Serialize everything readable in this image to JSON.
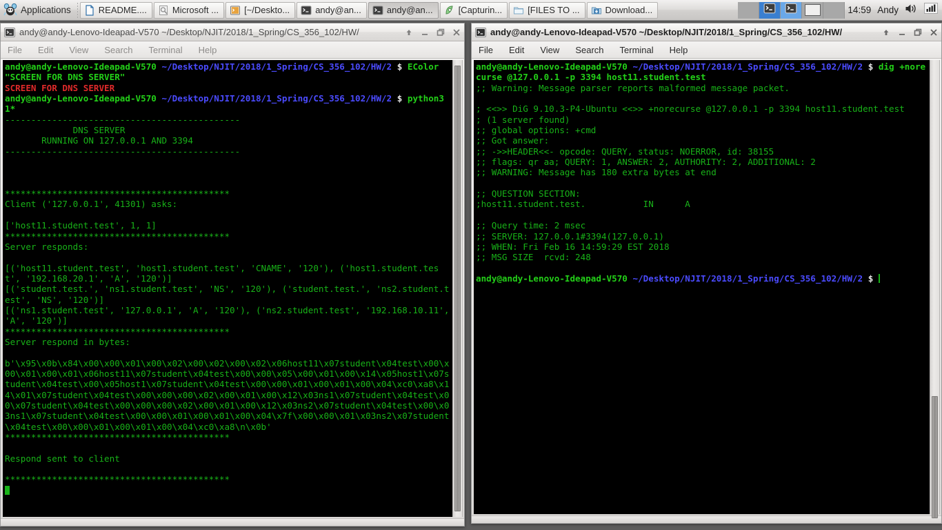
{
  "taskbar": {
    "applications_label": "Applications",
    "applications_icon": "xfce-mouse-icon",
    "buttons": [
      {
        "label": "README....",
        "icon": "document-icon",
        "active": false
      },
      {
        "label": "Microsoft ...",
        "icon": "pdf-viewer-icon",
        "active": false
      },
      {
        "label": "[~/Deskto...",
        "icon": "terminal-icon",
        "active": false
      },
      {
        "label": "andy@an...",
        "icon": "terminal-icon",
        "active": false
      },
      {
        "label": "andy@an...",
        "icon": "terminal-icon",
        "active": true
      },
      {
        "label": "[Capturin...",
        "icon": "screen-recorder-icon",
        "active": false
      },
      {
        "label": "[FILES TO ...",
        "icon": "folder-icon",
        "active": false
      },
      {
        "label": "Download...",
        "icon": "download-icon",
        "active": false
      }
    ],
    "pager": {
      "cells": [
        {
          "state": "empty",
          "icon": ""
        },
        {
          "state": "selected",
          "icon": "terminal-icon"
        },
        {
          "state": "selected-light",
          "icon": "terminal-icon"
        },
        {
          "state": "window",
          "icon": "window-thumb-icon"
        },
        {
          "state": "empty",
          "icon": ""
        }
      ]
    },
    "clock": "14:59",
    "username": "Andy",
    "volume_icon": "speaker-icon",
    "network_icon": "signal-bars-icon"
  },
  "window_left": {
    "icon": "terminal-icon",
    "title": "andy@andy-Lenovo-Ideapad-V570 ~/Desktop/NJIT/2018/1_Spring/CS_356_102/HW/",
    "buttons": {
      "shade": "shade-button",
      "minimize": "minimize-button",
      "maximize": "maximize-button",
      "close": "close-button"
    },
    "menu": [
      "File",
      "Edit",
      "View",
      "Search",
      "Terminal",
      "Help"
    ],
    "terminal": {
      "prompt_user": "andy@andy-Lenovo-Ideapad-V570",
      "prompt_path": "~/Desktop/NJIT/2018/1_Spring/CS_356_102/HW/2",
      "prompt_symbol": "$",
      "command_1": "EColor \"SCREEN FOR DNS SERVER\"",
      "banner_red": "SCREEN FOR DNS SERVER",
      "command_2": "python3 1*",
      "divider": "---------------------------------------------",
      "server_title": "DNS SERVER",
      "server_running": "RUNNING ON 127.0.0.1 AND 3394",
      "stars": "*******************************************",
      "client_asks": "Client ('127.0.0.1', 41301) asks:",
      "query": "['host11.student.test', 1, 1]",
      "server_responds_label": "Server responds:",
      "records": [
        "[('host11.student.test', 'host1.student.test', 'CNAME', '120'), ('host1.student.test', '192.168.20.1', 'A', '120')]",
        "[('student.test.', 'ns1.student.test', 'NS', '120'), ('student.test.', 'ns2.student.test', 'NS', '120')]",
        "[('ns1.student.test', '127.0.0.1', 'A', '120'), ('ns2.student.test', '192.168.10.11', 'A', '120')]"
      ],
      "server_bytes_label": "Server respond in bytes:",
      "bytes_blob": "b'\\x95\\x0b\\x84\\x00\\x00\\x01\\x00\\x02\\x00\\x02\\x00\\x02\\x06host11\\x07student\\x04test\\x00\\x00\\x01\\x00\\x01\\x06host11\\x07student\\x04test\\x00\\x00\\x05\\x00\\x01\\x00\\x14\\x05host1\\x07student\\x04test\\x00\\x05host1\\x07student\\x04test\\x00\\x00\\x01\\x00\\x01\\x00\\x04\\xc0\\xa8\\x14\\x01\\x07student\\x04test\\x00\\x00\\x00\\x02\\x00\\x01\\x00\\x12\\x03ns1\\x07student\\x04test\\x00\\x07student\\x04test\\x00\\x00\\x00\\x02\\x00\\x01\\x00\\x12\\x03ns2\\x07student\\x04test\\x00\\x03ns1\\x07student\\x04test\\x00\\x00\\x01\\x00\\x01\\x00\\x04\\x7f\\x00\\x00\\x01\\x03ns2\\x07student\\x04test\\x00\\x00\\x01\\x00\\x01\\x00\\x04\\xc0\\xa8\\n\\x0b'",
      "respond_sent": "Respond sent to client"
    }
  },
  "window_right": {
    "icon": "terminal-icon",
    "title": "andy@andy-Lenovo-Ideapad-V570 ~/Desktop/NJIT/2018/1_Spring/CS_356_102/HW/",
    "buttons": {
      "shade": "shade-button",
      "minimize": "minimize-button",
      "maximize": "maximize-button",
      "close": "close-button"
    },
    "menu": [
      "File",
      "Edit",
      "View",
      "Search",
      "Terminal",
      "Help"
    ],
    "terminal": {
      "prompt_user": "andy@andy-Lenovo-Ideapad-V570",
      "prompt_path": "~/Desktop/NJIT/2018/1_Spring/CS_356_102/HW/2",
      "prompt_symbol": "$",
      "command": "dig +norecurse @127.0.0.1 -p 3394 host11.student.test",
      "lines": [
        ";; Warning: Message parser reports malformed message packet.",
        "",
        "; <<>> DiG 9.10.3-P4-Ubuntu <<>> +norecurse @127.0.0.1 -p 3394 host11.student.test",
        "; (1 server found)",
        ";; global options: +cmd",
        ";; Got answer:",
        ";; ->>HEADER<<- opcode: QUERY, status: NOERROR, id: 38155",
        ";; flags: qr aa; QUERY: 1, ANSWER: 2, AUTHORITY: 2, ADDITIONAL: 2",
        ";; WARNING: Message has 180 extra bytes at end",
        "",
        ";; QUESTION SECTION:",
        ";host11.student.test.\t\tIN\tA",
        "",
        ";; Query time: 2 msec",
        ";; SERVER: 127.0.0.1#3394(127.0.0.1)",
        ";; WHEN: Fri Feb 16 14:59:29 EST 2018",
        ";; MSG SIZE  rcvd: 248",
        ""
      ]
    }
  },
  "colors": {
    "terminal_bg": "#000000",
    "terminal_fg": "#18b218",
    "prompt_user": "#23d018",
    "prompt_path": "#4b4bff",
    "alert_red": "#e02a2a",
    "taskbar_bg": "#dedcda",
    "pager_selected": "#3a7fd0"
  }
}
